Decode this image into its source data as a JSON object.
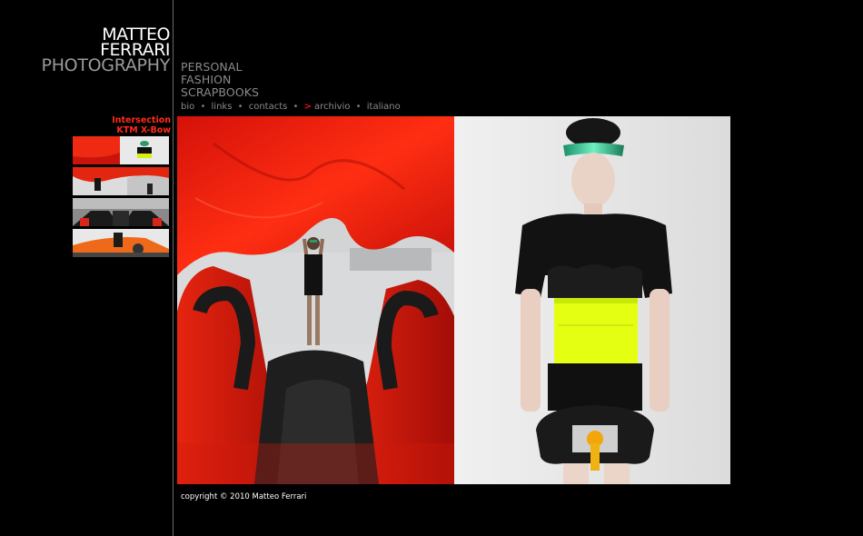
{
  "logo": {
    "line1": "MATTEO",
    "line2": "FERRARI",
    "line3": "PHOTOGRAPHY"
  },
  "categories": [
    "PERSONAL",
    "FASHION",
    "SCRAPBOOKS"
  ],
  "subnav": {
    "items": [
      "bio",
      "links",
      "contacts",
      "archivio",
      "italiano"
    ],
    "separator": "•",
    "active_marker": ">"
  },
  "gallery": {
    "title_line1": "Intersection",
    "title_line2": "KTM X-Bow"
  },
  "thumbnails": [
    {
      "name": "thumb-1"
    },
    {
      "name": "thumb-2"
    },
    {
      "name": "thumb-3"
    },
    {
      "name": "thumb-4"
    }
  ],
  "footer": {
    "copyright": "copyright © 2010 Matteo Ferrari"
  },
  "colors": {
    "background": "#000000",
    "divider": "#6a6a6a",
    "accent_red": "#ff2a1a",
    "muted_text": "#8a8a8a"
  }
}
